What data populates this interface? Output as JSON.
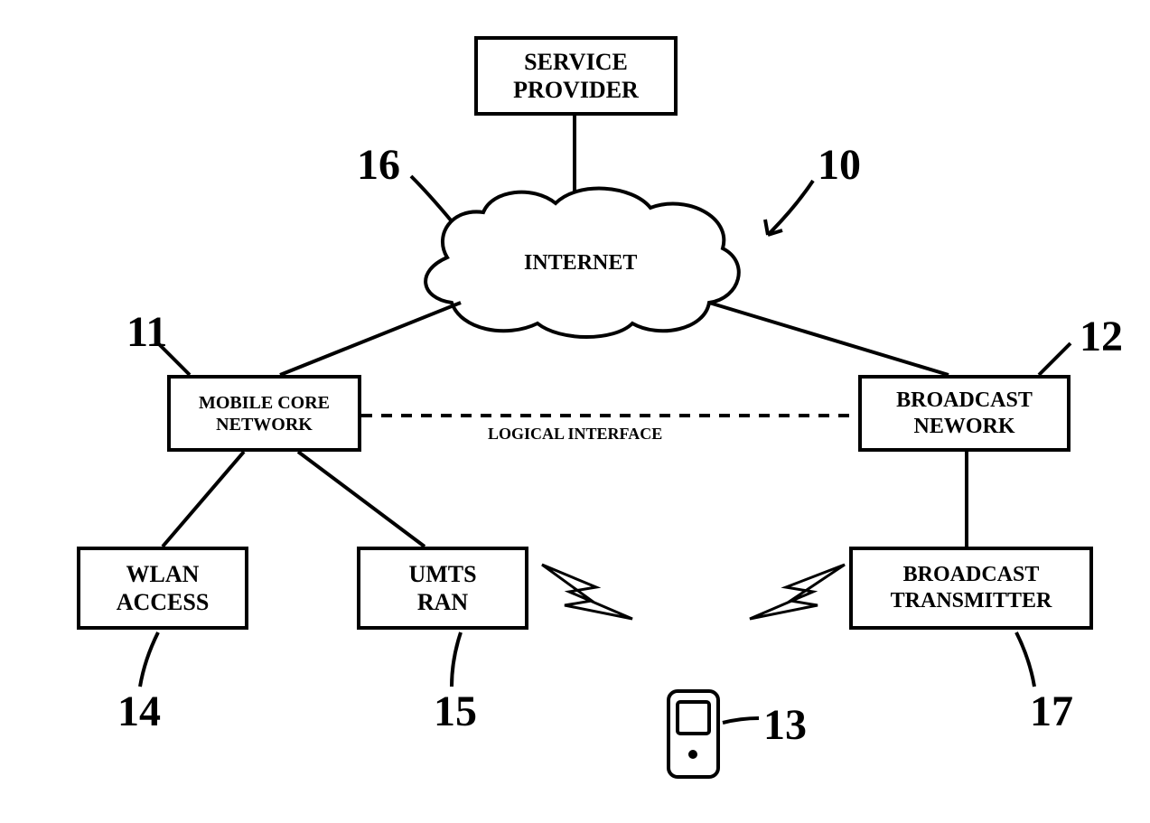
{
  "boxes": {
    "serviceProvider": "SERVICE\nPROVIDER",
    "internet": "INTERNET",
    "mobileCore": "MOBILE CORE\nNETWORK",
    "broadcastNetwork": "BROADCAST\nNEWORK",
    "wlanAccess": "WLAN\nACCESS",
    "umtsRan": "UMTS\nRAN",
    "broadcastTransmitter": "BROADCAST\nTRANSMITTER",
    "logicalInterface": "LOGICAL INTERFACE"
  },
  "refNumbers": {
    "r10": "10",
    "r11": "11",
    "r12": "12",
    "r13": "13",
    "r14": "14",
    "r15": "15",
    "r16": "16",
    "r17": "17"
  }
}
